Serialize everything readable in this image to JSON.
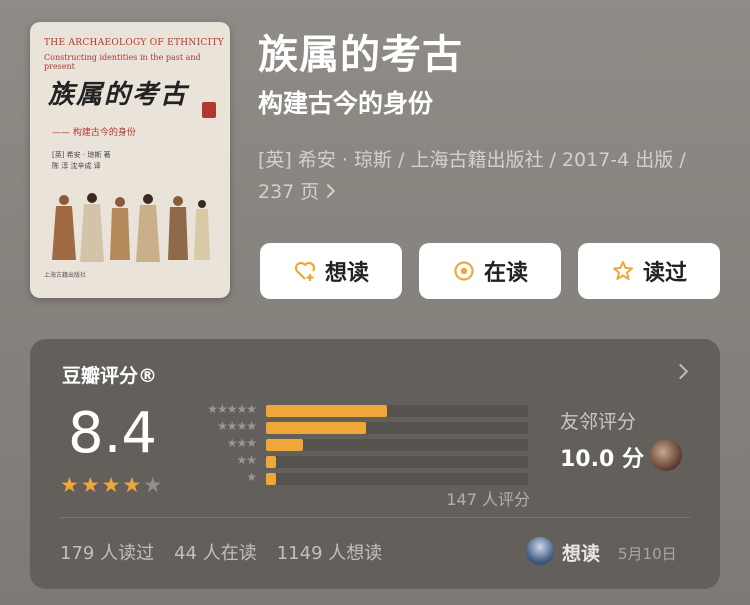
{
  "book": {
    "title": "族属的考古",
    "subtitle": "构建古今的身份",
    "meta": "[英] 希安 · 琼斯 / 上海古籍出版社 / 2017-4 出版 / 237 页"
  },
  "cover": {
    "en_title": "THE ARCHAEOLOGY OF ETHNICITY",
    "en_subtitle": "Constructing identities in the past and present",
    "cn_title": "族属的考古",
    "cn_subtitle": "—— 构建古今的身份",
    "authors": [
      "[英] 希安 · 琼斯 著",
      "陈 淳   沈辛成 译"
    ],
    "publisher": "上海古籍出版社"
  },
  "actions": [
    {
      "label": "想读",
      "icon": "heart-plus-icon"
    },
    {
      "label": "在读",
      "icon": "reading-circle-icon"
    },
    {
      "label": "读过",
      "icon": "star-outline-icon"
    }
  ],
  "rating": {
    "header": "豆瓣评分®",
    "score": "8.4",
    "stars_filled": 4,
    "stars_total": 5,
    "distribution": [
      {
        "stars": "★★★★★",
        "fraction": 0.46
      },
      {
        "stars": "★★★★",
        "fraction": 0.38
      },
      {
        "stars": "★★★",
        "fraction": 0.14
      },
      {
        "stars": "★★",
        "fraction": 0.04
      },
      {
        "stars": "★",
        "fraction": 0.04
      }
    ],
    "count_text": "147 人评分",
    "friend_label": "友邻评分",
    "friend_score": "10.0 分",
    "stats": [
      "179 人读过",
      "44 人在读",
      "1149 人想读"
    ],
    "my_status": "想读",
    "my_date": "5月10日"
  },
  "colors": {
    "accent": "#f0a73a",
    "card_bg": "#635f5b",
    "page_bg": "#8f8b86"
  }
}
